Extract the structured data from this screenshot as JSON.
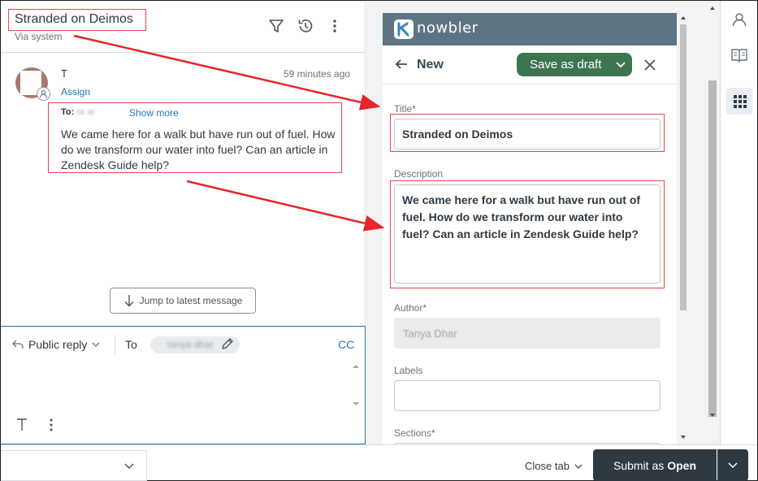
{
  "ticket": {
    "subject": "Stranded on Deimos",
    "via": "Via system"
  },
  "message": {
    "sender_initial": "T",
    "time": "59 minutes ago",
    "assign_label": "Assign",
    "to_label": "To:",
    "to_recipient": "ta      ar",
    "show_more_label": "Show more",
    "body": "We came here for a walk but have run out of fuel. How do we transform our water into fuel? Can an article in Zendesk Guide help?"
  },
  "jump_button_label": "Jump to latest message",
  "composer": {
    "reply_type": "Public reply",
    "to_label": "To",
    "recipient": "tanya dhar",
    "cc_label": "CC"
  },
  "bottom_bar": {
    "close_tab_label": "Close tab",
    "submit_prefix": "Submit as",
    "submit_status": "Open"
  },
  "app": {
    "brand_name": "nowbler",
    "page_heading": "New",
    "save_draft_label": "Save as draft",
    "form": {
      "title_label": "Title*",
      "title_value": "Stranded on Deimos",
      "description_label": "Description",
      "description_value": "We came here for a walk but have run out of fuel. How do we transform our water into fuel? Can an article in Zendesk Guide help?",
      "author_label": "Author*",
      "author_value": "Tanya Dhar",
      "labels_label": "Labels",
      "labels_value": "",
      "sections_label": "Sections*"
    }
  },
  "colors": {
    "annotation_red": "#e0474c",
    "brand_bar": "#5f7482",
    "save_draft_green": "#3e7551",
    "submit_dark": "#2f3941",
    "link_blue": "#1f73b7"
  }
}
